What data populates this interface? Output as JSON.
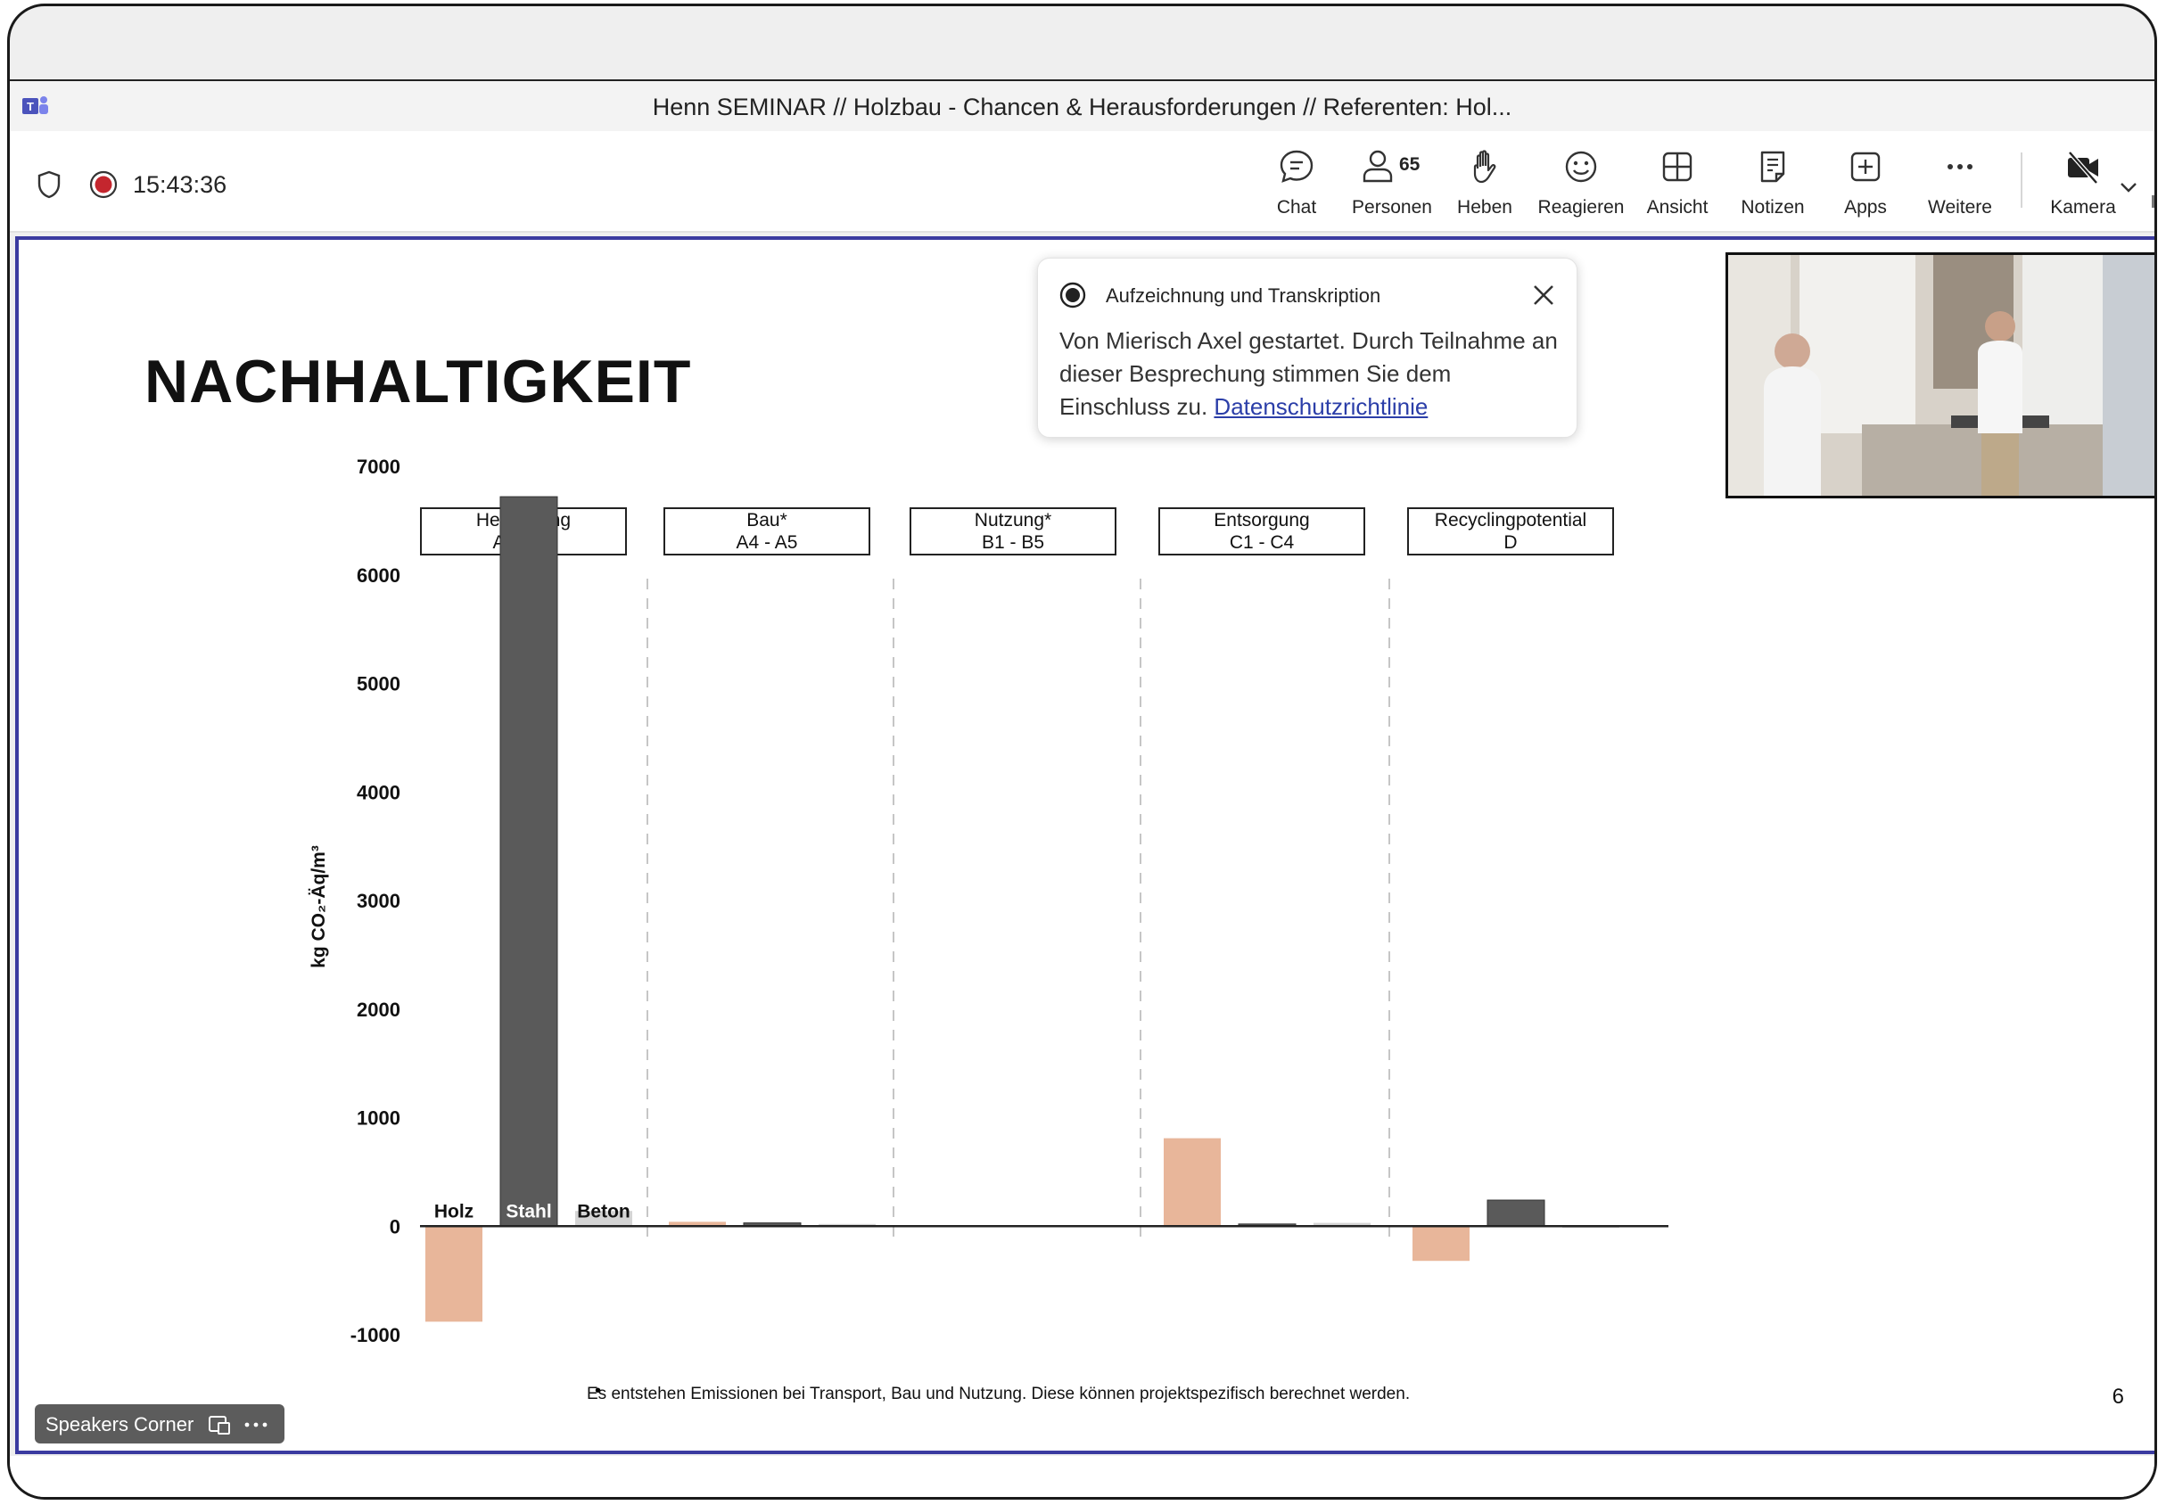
{
  "window": {
    "title": "Henn SEMINAR // Holzbau - Chancen & Herausforderungen // Referenten: Hol..."
  },
  "toolbar": {
    "time": "15:43:36",
    "chat": "Chat",
    "people_count": "65",
    "people": "Personen",
    "raise": "Heben",
    "react": "Reagieren",
    "view": "Ansicht",
    "notes": "Notizen",
    "apps": "Apps",
    "more": "Weitere",
    "camera": "Kamera"
  },
  "toast": {
    "title": "Aufzeichnung und Transkription",
    "body": "Von Mierisch Axel gestartet. Durch Teilnahme an dieser Besprechung stimmen Sie dem Einschluss zu.",
    "link": "Datenschutzrichtlinie"
  },
  "slide": {
    "title": "NACHHALTIGKEIT",
    "footnote_bullet": "•",
    "footnote": "Es entstehen Emissionen bei Transport, Bau und Nutzung. Diese können projektspezifisch berechnet werden.",
    "page_number": "6"
  },
  "stage": {
    "speakers_corner": "Speakers Corner"
  },
  "chart_data": {
    "type": "bar",
    "ylabel": "kg CO₂-Äq/m³",
    "ylim": [
      -1000,
      7000
    ],
    "yticks": [
      -1000,
      0,
      1000,
      2000,
      3000,
      4000,
      5000,
      6000,
      7000
    ],
    "groups": [
      {
        "label_line1": "Herstellung",
        "label_line2": "A1 - A3"
      },
      {
        "label_line1": "Bau*",
        "label_line2": "A4 - A5"
      },
      {
        "label_line1": "Nutzung*",
        "label_line2": "B1 - B5"
      },
      {
        "label_line1": "Entsorgung",
        "label_line2": "C1 - C4"
      },
      {
        "label_line1": "Recyclingpotential",
        "label_line2": "D"
      }
    ],
    "series": [
      {
        "name": "Holz",
        "color": "#e8b69a",
        "values": [
          -880,
          40,
          0,
          810,
          -320
        ]
      },
      {
        "name": "Stahl",
        "color": "#5a5a5a",
        "values": [
          6720,
          30,
          0,
          20,
          240
        ]
      },
      {
        "name": "Beton",
        "color": "#d4d4d4",
        "values": [
          140,
          20,
          0,
          30,
          -15
        ]
      }
    ]
  }
}
